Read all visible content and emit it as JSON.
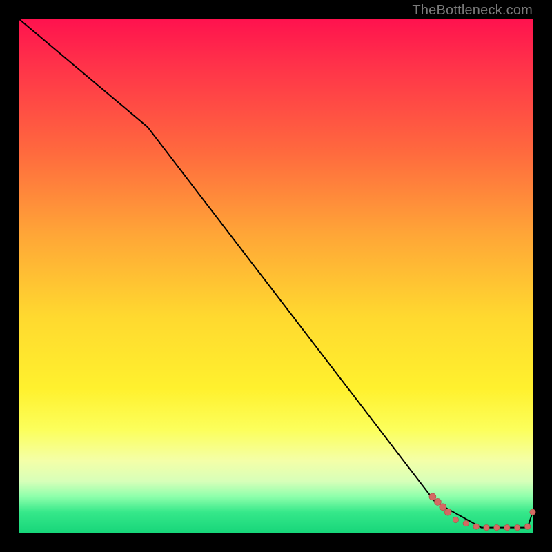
{
  "watermark": "TheBottleneck.com",
  "colors": {
    "line": "#000000",
    "marker_fill": "#d46a63",
    "marker_stroke": "#b24d46"
  },
  "chart_data": {
    "type": "line",
    "title": "",
    "xlabel": "",
    "ylabel": "",
    "xlim": [
      0,
      100
    ],
    "ylim": [
      0,
      100
    ],
    "grid": false,
    "series": [
      {
        "name": "curve",
        "x": [
          0,
          25,
          81,
          90,
          99,
          100
        ],
        "y": [
          100,
          79,
          6,
          1,
          1,
          4
        ]
      }
    ],
    "markers": {
      "name": "highlight-points",
      "x": [
        80.5,
        81.5,
        82.5,
        83.5,
        85,
        87,
        89,
        91,
        93,
        95,
        97,
        99,
        100
      ],
      "y": [
        7,
        6,
        5,
        4,
        2.5,
        1.8,
        1.2,
        1,
        1,
        1,
        1,
        1.2,
        4
      ]
    }
  }
}
